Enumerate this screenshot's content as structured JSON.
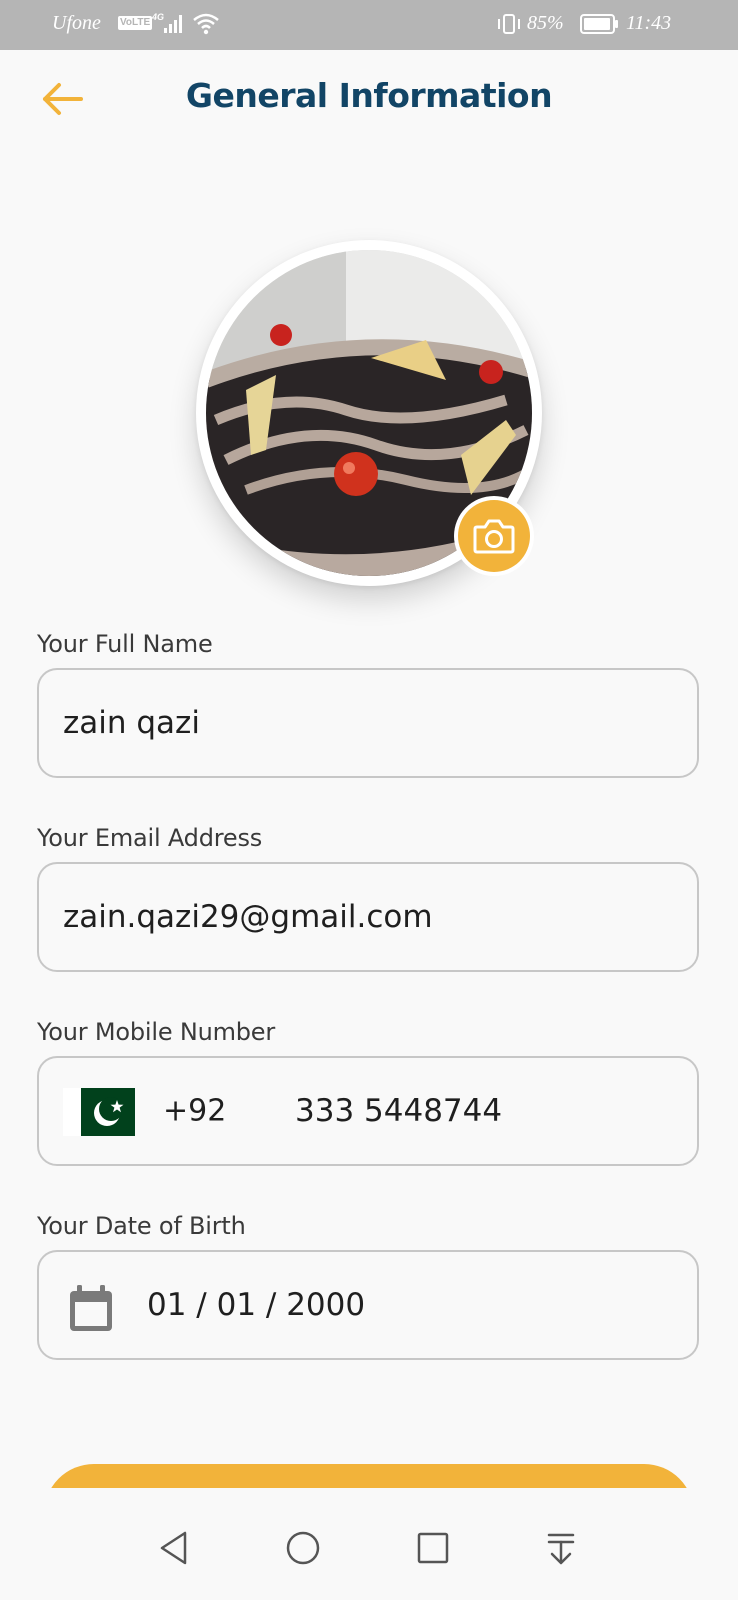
{
  "status_bar": {
    "carrier": "Ufone",
    "network_badge": "VoLTE",
    "network_type": "4G",
    "battery": "85%",
    "time": "11:43"
  },
  "header": {
    "title": "General Information",
    "back_icon": "arrow-left-icon"
  },
  "profile": {
    "camera_icon": "camera-icon"
  },
  "fields": {
    "full_name": {
      "label": "Your Full Name",
      "value": "zain qazi"
    },
    "email": {
      "label": "Your Email Address",
      "value": "zain.qazi29@gmail.com"
    },
    "mobile": {
      "label": "Your Mobile Number",
      "country_flag": "pakistan-flag-icon",
      "country_code": "+92",
      "value": "333 5448744"
    },
    "dob": {
      "label": "Your Date of Birth",
      "icon": "calendar-icon",
      "value": "01 / 01 / 2000"
    }
  },
  "nav": {
    "back": "triangle-back-icon",
    "home": "circle-home-icon",
    "recents": "square-recents-icon",
    "notifications": "pull-down-icon"
  },
  "colors": {
    "accent": "#f2b33a",
    "title": "#124566",
    "background": "#f9f9f9",
    "status_bar": "#b5b5b5",
    "field_border": "#c7c7c7"
  }
}
